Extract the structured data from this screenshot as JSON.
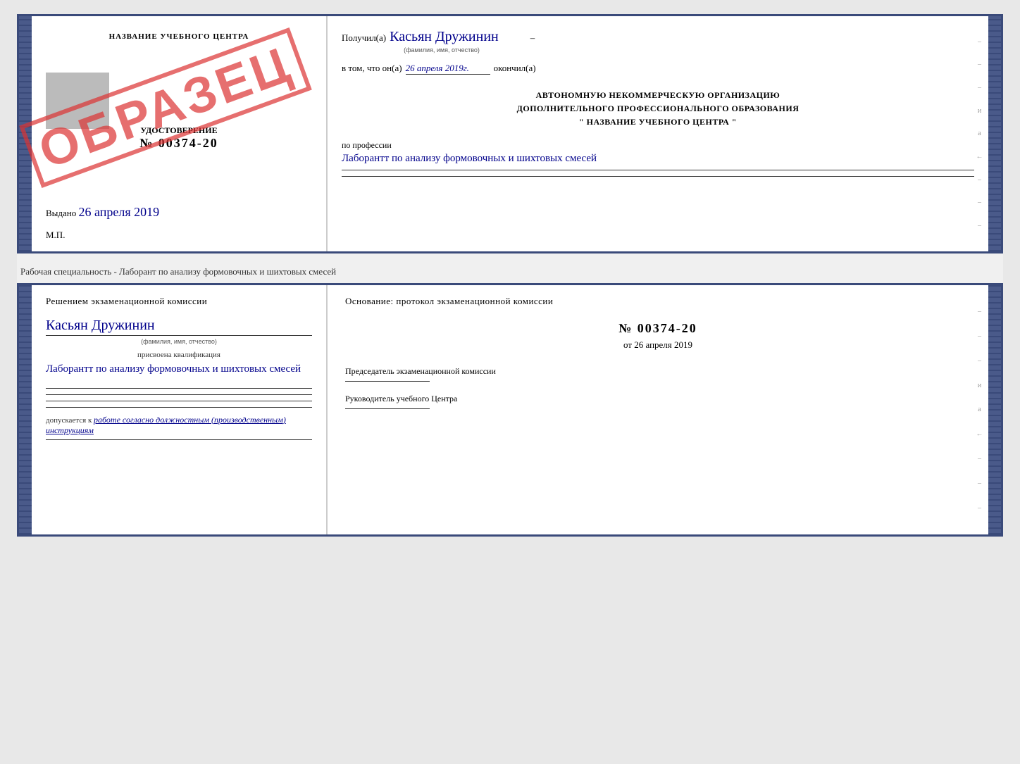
{
  "doc1": {
    "left": {
      "title": "НАЗВАНИЕ УЧЕБНОГО ЦЕНТРА",
      "cert_label": "УДОСТОВЕРЕНИЕ",
      "cert_number": "№ 00374-20",
      "issued_label": "Выдано",
      "issued_date": "26 апреля 2019",
      "mp_label": "М.П.",
      "obrazec": "ОБРАЗЕЦ"
    },
    "right": {
      "received_prefix": "Получил(а)",
      "received_name": "Касьян Дружинин",
      "name_caption": "(фамилия, имя, отчество)",
      "dash": "–",
      "date_prefix": "в том, что он(а)",
      "date_value": "26 апреля 2019г.",
      "finished_label": "окончил(а)",
      "org_line1": "АВТОНОМНУЮ НЕКОММЕРЧЕСКУЮ ОРГАНИЗАЦИЮ",
      "org_line2": "ДОПОЛНИТЕЛЬНОГО ПРОФЕССИОНАЛЬНОГО ОБРАЗОВАНИЯ",
      "org_line3": "\" НАЗВАНИЕ УЧЕБНОГО ЦЕНТРА \"",
      "profession_prefix": "по профессии",
      "profession_value": "Лаборантт по анализу формовочных и шихтовых смесей",
      "side_marks": [
        "-",
        "-",
        "-",
        "и",
        "а",
        "←",
        "-",
        "-",
        "-"
      ]
    }
  },
  "between": {
    "label": "Рабочая специальность - Лаборант по анализу формовочных и шихтовых смесей"
  },
  "doc2": {
    "left": {
      "decision_title": "Решением экзаменационной комиссии",
      "name": "Касьян Дружинин",
      "name_caption": "(фамилия, имя, отчество)",
      "qual_label": "присвоена квалификация",
      "qual_value": "Лаборантт по анализу формовочных и шихтовых смесей",
      "allowed_prefix": "допускается к",
      "allowed_italic": "работе согласно должностным (производственным) инструкциям"
    },
    "right": {
      "basis_title": "Основание: протокол экзаменационной комиссии",
      "number_prefix": "№",
      "number_value": "00374-20",
      "date_prefix": "от",
      "date_value": "26 апреля 2019",
      "chairman_label": "Председатель экзаменационной комиссии",
      "director_label": "Руководитель учебного Центра",
      "side_marks": [
        "-",
        "-",
        "-",
        "и",
        "а",
        "←",
        "-",
        "-",
        "-"
      ]
    }
  }
}
